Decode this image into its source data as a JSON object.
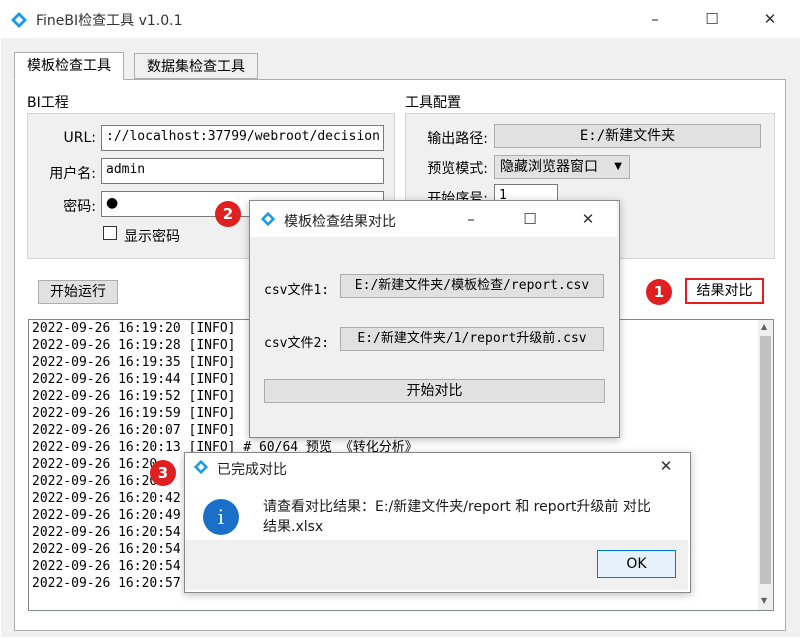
{
  "window": {
    "title": "FineBI检查工具 v1.0.1",
    "min": "–",
    "max": "☐",
    "close": "✕"
  },
  "tabs": [
    {
      "label": "模板检查工具"
    },
    {
      "label": "数据集检查工具"
    }
  ],
  "bi_project": {
    "group_label": "BI工程",
    "url_label": "URL:",
    "url_value": "://localhost:37799/webroot/decision",
    "username_label": "用户名:",
    "username_value": "admin",
    "password_label": "密码:",
    "password_value": "●",
    "show_password_label": "显示密码"
  },
  "tool_config": {
    "group_label": "工具配置",
    "output_path_label": "输出路径:",
    "output_path_value": "E:/新建文件夹",
    "preview_mode_label": "预览模式:",
    "preview_mode_value": "隐藏浏览器窗口",
    "start_index_label": "开始序号:",
    "start_index_value": "1"
  },
  "actions": {
    "start_run": "开始运行",
    "compare_results": "结果对比"
  },
  "log_lines": [
    "2022-09-26 16:19:20 [INFO]",
    "2022-09-26 16:19:28 [INFO]",
    "2022-09-26 16:19:35 [INFO]",
    "2022-09-26 16:19:44 [INFO]",
    "2022-09-26 16:19:52 [INFO]",
    "2022-09-26 16:19:59 [INFO]",
    "2022-09-26 16:20:07 [INFO]",
    "2022-09-26 16:20:13 [INFO] # 60/64 预览 《转化分析》",
    "2022-09-26 16:20:",
    "2022-09-26 16:20:",
    "2022-09-26 16:20:42",
    "2022-09-26 16:20:49",
    "2022-09-26 16:20:54",
    "2022-09-26 16:20:54",
    "2022-09-26 16:20:54",
    "2022-09-26 16:20:57"
  ],
  "compare_dialog": {
    "title": "模板检查结果对比",
    "csv1_label": "csv文件1:",
    "csv1_value": "E:/新建文件夹/模板检查/report.csv",
    "csv2_label": "csv文件2:",
    "csv2_value": "E:/新建文件夹/1/report升级前.csv",
    "start_compare": "开始对比"
  },
  "done_dialog": {
    "title": "已完成对比",
    "message": "请查看对比结果：E:/新建文件夹/report 和 report升级前 对比结果.xlsx",
    "ok": "OK",
    "info_glyph": "i"
  },
  "badges": {
    "b1": "1",
    "b2": "2",
    "b3": "3"
  },
  "colors": {
    "accent": "#0078d7",
    "highlight": "#e02020",
    "info": "#1a6fc9"
  }
}
